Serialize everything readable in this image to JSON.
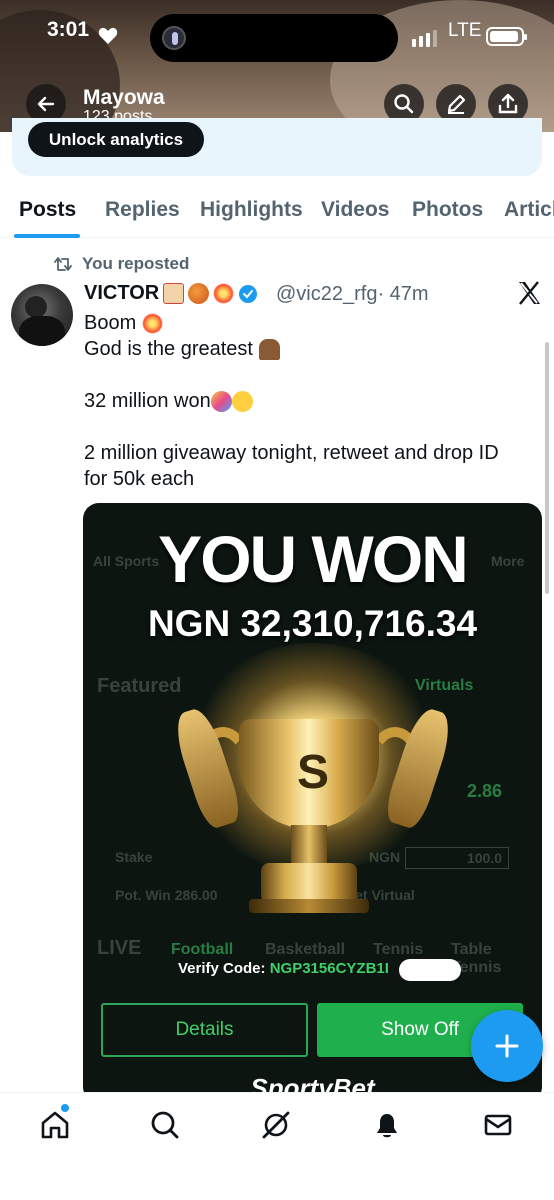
{
  "status_bar": {
    "time": "3:01",
    "network": "LTE"
  },
  "header": {
    "name": "Mayowa",
    "posts_count": "123 posts",
    "unlock_label": "Unlock analytics"
  },
  "tabs": [
    "Posts",
    "Replies",
    "Highlights",
    "Videos",
    "Photos",
    "Articles"
  ],
  "active_tab": "Posts",
  "post": {
    "repost_label": "You reposted",
    "author_name": "VICTOR",
    "author_handle": "@vic22_rfg",
    "time_ago": "· 47m",
    "line1": "Boom",
    "line2": "God is the greatest",
    "line3": "32 million won",
    "line4": "2 million giveaway tonight, retweet and drop ID",
    "line5": "for 50k each"
  },
  "media": {
    "headline": "YOU WON",
    "amount": "NGN 32,310,716.34",
    "verify_label": "Verify Code:",
    "verify_code": "NGP3156CYZB1I",
    "details_label": "Details",
    "showoff_label": "Show Off",
    "brand": "SportyBet",
    "bg_text": {
      "all_sports": "All Sports",
      "more": "More",
      "featured": "Featured",
      "virtuals": "Virtuals",
      "stake": "Stake",
      "ngn": "NGN",
      "stake_value": "100.0",
      "pot_win": "Pot. Win  286.00",
      "bet_virtual": "Bet Virtual",
      "odds": "2.86",
      "live": "LIVE",
      "football": "Football",
      "basketball": "Basketball",
      "tennis": "Tennis",
      "table_tennis": "Table Tennis"
    }
  },
  "colors": {
    "accent": "#1d9bf0",
    "text": "#0f1419",
    "muted": "#536471",
    "sporty_green": "#1fb04d"
  },
  "nav_icons": [
    "home-icon",
    "search-icon",
    "grok-icon",
    "notifications-icon",
    "messages-icon"
  ]
}
